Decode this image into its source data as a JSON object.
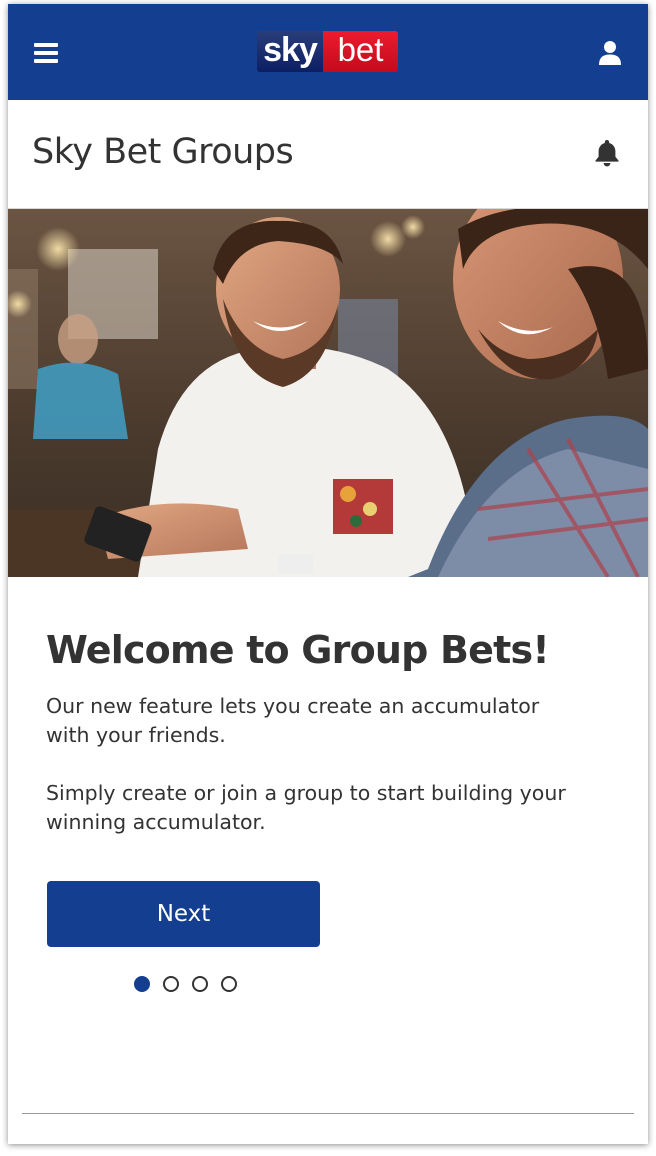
{
  "header": {
    "logo_sky": "sky",
    "logo_bet": "bet",
    "bg_color": "#143f91"
  },
  "subheader": {
    "title": "Sky Bet Groups"
  },
  "main": {
    "heading": "Welcome to Group Bets!",
    "paragraph_1": "Our new feature lets you create an accumulator with your friends.",
    "paragraph_2": "Simply create or join a group to start building your winning accumulator.",
    "next_label": "Next"
  },
  "pagination": {
    "total": 4,
    "active_index": 0
  },
  "icons": [
    "menu-icon",
    "user-icon",
    "bell-icon"
  ],
  "colors": {
    "brand_blue": "#143f91",
    "brand_red": "#e01a2c",
    "text": "#333333"
  }
}
